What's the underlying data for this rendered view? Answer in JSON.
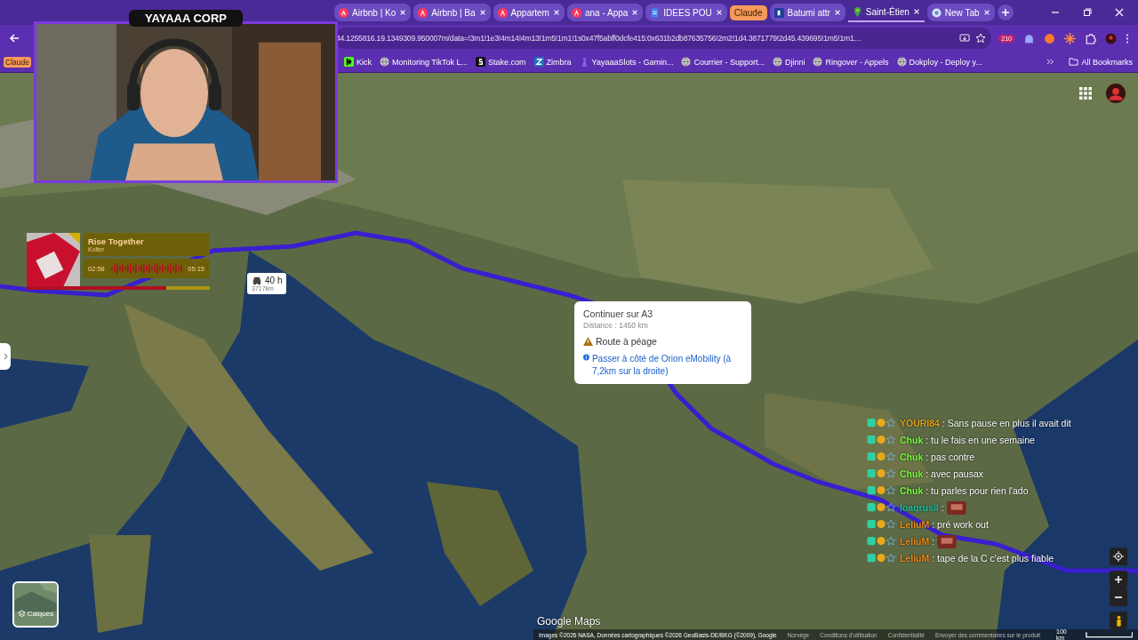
{
  "tabs": [
    {
      "kind": "airbnb",
      "label": "Airbnb | Ko",
      "selected": false
    },
    {
      "kind": "airbnb",
      "label": "Airbnb | Ba",
      "selected": false
    },
    {
      "kind": "airbnb",
      "label": "Appartem",
      "selected": false
    },
    {
      "kind": "airbnb",
      "label": "ana - Appa",
      "selected": false
    },
    {
      "kind": "doc",
      "label": "IDEES POU",
      "selected": false
    },
    {
      "kind": "group",
      "label": "Claude"
    },
    {
      "kind": "booking",
      "label": "Batumi attr",
      "selected": false
    },
    {
      "kind": "maps",
      "label": "Saint-Étien",
      "selected": true
    },
    {
      "kind": "chrome",
      "label": "New Tab",
      "selected": false
    }
  ],
  "address": "44.1255816.19.1349309.950007m/data=!3m1!1e3!4m14!4m13!1m5!1m1!1s0x47f5abff0dcfe415:0x631b2db87635756!2m2!1d4.3871779!2d45.439695!1m5!1m1…",
  "extension_badge": "210",
  "group_chip": "Claude",
  "bookmarks": [
    {
      "kind": "kick",
      "label": "Kick"
    },
    {
      "kind": "globe",
      "label": "Monitoring TikTok L..."
    },
    {
      "kind": "stake",
      "label": "Stake.com"
    },
    {
      "kind": "zimbra",
      "label": "Zimbra"
    },
    {
      "kind": "slots",
      "label": "YayaaaSlots - Gamin..."
    },
    {
      "kind": "globe",
      "label": "Courrier - Support..."
    },
    {
      "kind": "globe",
      "label": "Djinni"
    },
    {
      "kind": "globe",
      "label": "Ringover - Appels"
    },
    {
      "kind": "globe",
      "label": "Dokploy - Deploy y..."
    }
  ],
  "all_bookmarks": "All Bookmarks",
  "webcam": {
    "title": "YAYAAA CORP"
  },
  "music": {
    "title": "Rise Together",
    "artist": "Kolter",
    "elapsed": "02:58",
    "duration": "05:15",
    "level": 0.76
  },
  "trip": {
    "duration": "40 h",
    "distance": "3717km"
  },
  "popup": {
    "title": "Continuer sur A3",
    "distance": "Distance : 1450 km",
    "warning": "Route à péage",
    "info": "Passer à côté de Orion eMobility (à 7,2km sur la droite)"
  },
  "chat": [
    {
      "name": "YOURI84",
      "color": "#e0a020",
      "text": ": Sans pause en plus il avait dit",
      "emote": false
    },
    {
      "name": "Chuk",
      "color": "#7cfc40",
      "text": ": tu le fais en une semaine",
      "emote": false
    },
    {
      "name": "Chuk",
      "color": "#7cfc40",
      "text": ": pas contre",
      "emote": false
    },
    {
      "name": "Chuk",
      "color": "#7cfc40",
      "text": ": avec pausax",
      "emote": false
    },
    {
      "name": "Chuk",
      "color": "#7cfc40",
      "text": ": tu parles pour rien l'ado",
      "emote": false
    },
    {
      "name": "Ioaqrusil",
      "color": "#20c0a0",
      "text": ":",
      "emote": true
    },
    {
      "name": "LeliuM",
      "color": "#e88a1a",
      "text": ": pré work out",
      "emote": false
    },
    {
      "name": "LeliuM",
      "color": "#e88a1a",
      "text": ":",
      "emote": true
    },
    {
      "name": "LeliuM",
      "color": "#e88a1a",
      "text": ": tape de la C c'est plus fiable",
      "emote": false
    }
  ],
  "layers_button": "Calques",
  "logo": "Google Maps",
  "attribution": [
    "Images ©2026 NASA, Données cartographiques ©2026 GeoBasis-DE/BKG (©2009), Google",
    "Norvège",
    "Conditions d'utilisation",
    "Confidentialité",
    "Envoyer des commentaires sur le produit"
  ],
  "scale": "100 km"
}
